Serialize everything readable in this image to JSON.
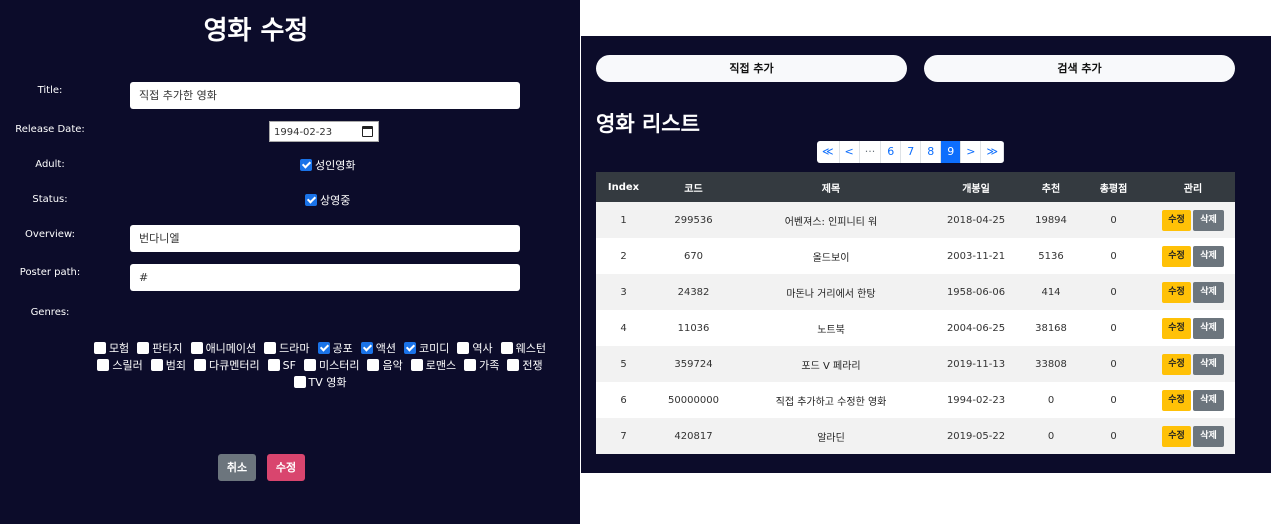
{
  "form": {
    "title": "영화 수정",
    "labels": {
      "title": "Title:",
      "release_date": "Release Date:",
      "adult": "Adult:",
      "status": "Status:",
      "overview": "Overview:",
      "poster_path": "Poster path:",
      "genres": "Genres:"
    },
    "values": {
      "title": "직접 추가한 영화",
      "release_date": "1994-02-23",
      "adult_label": "성인영화",
      "adult_checked": true,
      "status_label": "상영중",
      "status_checked": true,
      "overview": "번다니엘",
      "poster_path": "#"
    },
    "genres": [
      {
        "label": "모험",
        "checked": false
      },
      {
        "label": "판타지",
        "checked": false
      },
      {
        "label": "애니메이션",
        "checked": false
      },
      {
        "label": "드라마",
        "checked": false
      },
      {
        "label": "공포",
        "checked": true
      },
      {
        "label": "액션",
        "checked": true
      },
      {
        "label": "코미디",
        "checked": true
      },
      {
        "label": "역사",
        "checked": false
      },
      {
        "label": "웨스턴",
        "checked": false
      },
      {
        "label": "스릴러",
        "checked": false
      },
      {
        "label": "범죄",
        "checked": false
      },
      {
        "label": "다큐멘터리",
        "checked": false
      },
      {
        "label": "SF",
        "checked": false
      },
      {
        "label": "미스터리",
        "checked": false
      },
      {
        "label": "음악",
        "checked": false
      },
      {
        "label": "로맨스",
        "checked": false
      },
      {
        "label": "가족",
        "checked": false
      },
      {
        "label": "전쟁",
        "checked": false
      },
      {
        "label": "TV 영화",
        "checked": false
      }
    ],
    "cancel_label": "취소",
    "submit_label": "수정"
  },
  "list": {
    "add_direct_label": "직접 추가",
    "add_search_label": "검색 추가",
    "heading": "영화 리스트",
    "pagination": [
      "≪",
      "<",
      "···",
      "6",
      "7",
      "8",
      "9",
      ">",
      "≫"
    ],
    "active_page": "9",
    "columns": [
      "Index",
      "코드",
      "제목",
      "개봉일",
      "추천",
      "총평점",
      "관리"
    ],
    "edit_label": "수정",
    "delete_label": "삭제",
    "rows": [
      {
        "index": "1",
        "code": "299536",
        "title": "어벤져스: 인피니티 워",
        "date": "2018-04-25",
        "rec": "19894",
        "score": "0"
      },
      {
        "index": "2",
        "code": "670",
        "title": "올드보이",
        "date": "2003-11-21",
        "rec": "5136",
        "score": "0"
      },
      {
        "index": "3",
        "code": "24382",
        "title": "마돈나 거리에서 한탕",
        "date": "1958-06-06",
        "rec": "414",
        "score": "0"
      },
      {
        "index": "4",
        "code": "11036",
        "title": "노트북",
        "date": "2004-06-25",
        "rec": "38168",
        "score": "0"
      },
      {
        "index": "5",
        "code": "359724",
        "title": "포드 V 페라리",
        "date": "2019-11-13",
        "rec": "33808",
        "score": "0"
      },
      {
        "index": "6",
        "code": "50000000",
        "title": "직접 추가하고 수정한 영화",
        "date": "1994-02-23",
        "rec": "0",
        "score": "0"
      },
      {
        "index": "7",
        "code": "420817",
        "title": "알라딘",
        "date": "2019-05-22",
        "rec": "0",
        "score": "0"
      }
    ]
  }
}
